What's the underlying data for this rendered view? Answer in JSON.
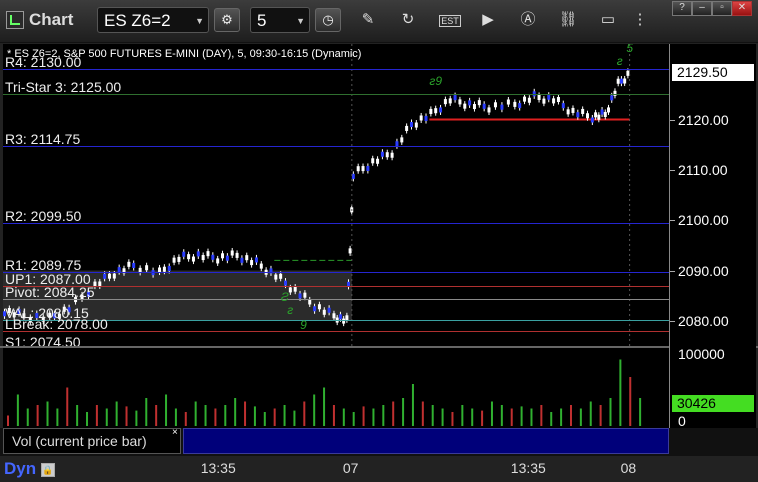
{
  "toolbar": {
    "title": "Chart",
    "symbol": "ES Z6=2",
    "interval": "5"
  },
  "window_controls": [
    "?",
    "–",
    "▫",
    "✕"
  ],
  "status_line": "* ES Z6=2, S&P 500 FUTURES E-MINI (DAY), 5, 09:30-16:15 (Dynamic)",
  "price_levels": [
    {
      "label": "R4: 2130.00",
      "price": 2130.0,
      "color": "#2525d0"
    },
    {
      "label": "Tri-Star 3: 2125.00",
      "price": 2125.0,
      "color": "#2f6f2f"
    },
    {
      "label": "R3: 2114.75",
      "price": 2114.75,
      "color": "#2525d0"
    },
    {
      "label": "R2: 2099.50",
      "price": 2099.5,
      "color": "#2525d0"
    },
    {
      "label": "R1: 2089.75",
      "price": 2089.75,
      "color": "#2525d0"
    },
    {
      "label": "UP1: 2087.00",
      "price": 2087.0,
      "color": "#b03030"
    },
    {
      "label": "Pivot: 2084.25",
      "price": 2084.25,
      "color": "#8a8a8a"
    },
    {
      "label": "VAL: 2080.15",
      "price": 2080.15,
      "color": "#3aa0a0"
    },
    {
      "label": "LBreak: 2078.00",
      "price": 2078.0,
      "color": "#b03030"
    },
    {
      "label": "S1: 2074.50",
      "price": 2074.5,
      "color": "#2525d0"
    }
  ],
  "price_axis": {
    "ticks": [
      "2120.00",
      "2110.00",
      "2100.00",
      "2090.00",
      "2080.00"
    ],
    "tick_values": [
      2120,
      2110,
      2100,
      2090,
      2080
    ],
    "last_price": "2129.50",
    "last_value": 2129.5,
    "range": [
      2075,
      2135
    ]
  },
  "volume_axis": {
    "max_label": "100000",
    "zero_label": "0",
    "last_volume": "30426",
    "last_fraction": 0.3
  },
  "volume_panel_label": "Vol (current price bar)",
  "time_axis": [
    "13:35",
    "07",
    "13:35",
    "08"
  ],
  "bottom_left": "Dyn",
  "markers": [
    {
      "text": "Ƨ",
      "xf": 0.43,
      "price": 2084.5
    },
    {
      "text": "ƨ",
      "xf": 0.44,
      "price": 2082.0
    },
    {
      "text": "9",
      "xf": 0.46,
      "price": 2079.0
    },
    {
      "text": "ƨ9",
      "xf": 0.66,
      "price": 2127.5
    },
    {
      "text": "ƨ",
      "xf": 0.95,
      "price": 2131.5
    },
    {
      "text": "5",
      "xf": 0.965,
      "price": 2134.0
    }
  ],
  "chart_data": {
    "type": "candlestick",
    "title": "",
    "close_path": [
      {
        "xf": 0.0,
        "price": 2082.0
      },
      {
        "xf": 0.03,
        "price": 2081.0
      },
      {
        "xf": 0.07,
        "price": 2080.5
      },
      {
        "xf": 0.1,
        "price": 2082.5
      },
      {
        "xf": 0.14,
        "price": 2087.0
      },
      {
        "xf": 0.17,
        "price": 2089.5
      },
      {
        "xf": 0.2,
        "price": 2091.0
      },
      {
        "xf": 0.24,
        "price": 2089.5
      },
      {
        "xf": 0.27,
        "price": 2092.5
      },
      {
        "xf": 0.3,
        "price": 2093.0
      },
      {
        "xf": 0.33,
        "price": 2092.5
      },
      {
        "xf": 0.36,
        "price": 2093.0
      },
      {
        "xf": 0.39,
        "price": 2091.5
      },
      {
        "xf": 0.42,
        "price": 2089.0
      },
      {
        "xf": 0.45,
        "price": 2086.0
      },
      {
        "xf": 0.48,
        "price": 2083.0
      },
      {
        "xf": 0.51,
        "price": 2081.0
      },
      {
        "xf": 0.53,
        "price": 2080.0
      },
      {
        "xf": 0.54,
        "price": 2109.0
      },
      {
        "xf": 0.57,
        "price": 2111.5
      },
      {
        "xf": 0.6,
        "price": 2113.5
      },
      {
        "xf": 0.63,
        "price": 2119.0
      },
      {
        "xf": 0.66,
        "price": 2121.0
      },
      {
        "xf": 0.69,
        "price": 2124.0
      },
      {
        "xf": 0.72,
        "price": 2123.0
      },
      {
        "xf": 0.75,
        "price": 2122.5
      },
      {
        "xf": 0.79,
        "price": 2123.0
      },
      {
        "xf": 0.82,
        "price": 2124.5
      },
      {
        "xf": 0.85,
        "price": 2124.0
      },
      {
        "xf": 0.88,
        "price": 2121.5
      },
      {
        "xf": 0.91,
        "price": 2120.5
      },
      {
        "xf": 0.93,
        "price": 2121.0
      },
      {
        "xf": 0.95,
        "price": 2127.0
      },
      {
        "xf": 0.97,
        "price": 2129.5
      }
    ],
    "volume_path": [
      0.15,
      0.45,
      0.25,
      0.3,
      0.35,
      0.25,
      0.55,
      0.3,
      0.2,
      0.3,
      0.25,
      0.35,
      0.28,
      0.22,
      0.4,
      0.3,
      0.45,
      0.25,
      0.2,
      0.35,
      0.3,
      0.25,
      0.3,
      0.4,
      0.35,
      0.28,
      0.2,
      0.25,
      0.3,
      0.22,
      0.35,
      0.45,
      0.55,
      0.3,
      0.25,
      0.2,
      0.28,
      0.25,
      0.3,
      0.35,
      0.4,
      0.6,
      0.35,
      0.3,
      0.25,
      0.2,
      0.3,
      0.25,
      0.22,
      0.35,
      0.3,
      0.25,
      0.28,
      0.25,
      0.3,
      0.2,
      0.25,
      0.3,
      0.25,
      0.35,
      0.3,
      0.4,
      0.95,
      0.7,
      0.4
    ],
    "range_box": {
      "x_from": 0.0,
      "x_to": 0.54,
      "price_from": 2080.0,
      "price_to": 2090.0
    },
    "ylim": [
      2075,
      2135
    ]
  }
}
